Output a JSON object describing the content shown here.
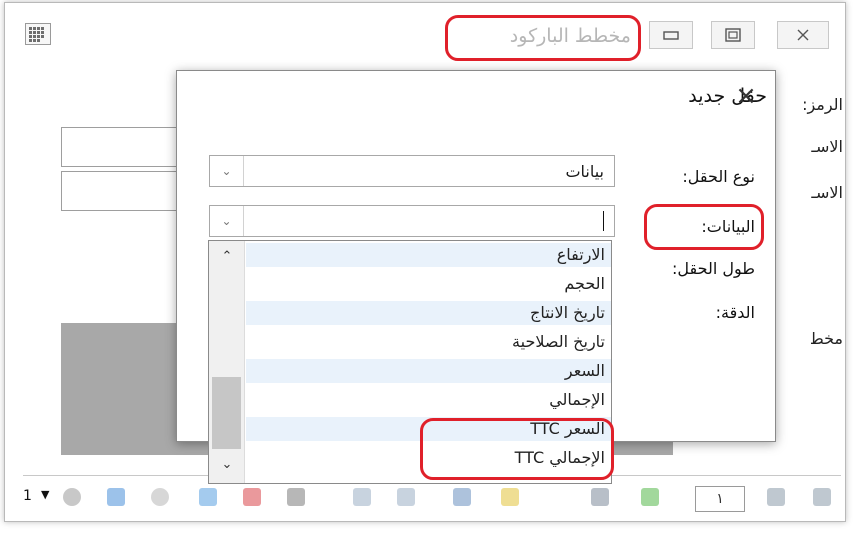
{
  "window": {
    "title": "مخطط الباركود",
    "colors": {
      "annotation": "#e0202a",
      "gray_panel": "#a8a8a8",
      "list_alt_row": "#e9f2fb"
    }
  },
  "background_form": {
    "label_code": "الرمز:",
    "label_name1": "الاسـ",
    "label_name2": "الاسـ",
    "label_scheme": "مخطط"
  },
  "dialog": {
    "title": "حقل جديد",
    "close_icon": "×",
    "field_type_label": "نوع الحقل:",
    "field_type_value": "بيانات",
    "data_label": "البيانات:",
    "data_value": "",
    "field_length_label": "طول الحقل:",
    "precision_label": "الدقة:"
  },
  "dropdown": {
    "items": [
      "الارتفاع",
      "الحجم",
      "تاريخ الانتاج",
      "تاريخ الصلاحية",
      "السعر",
      "الإجمالي",
      "السعر TTC",
      "الإجمالي TTC"
    ]
  },
  "toolbar": {
    "page_count": "1",
    "page_field": "١",
    "icons": [
      "link-icon",
      "sort-icon",
      "filter-icon",
      "refresh-icon",
      "delete-icon",
      "undo-icon",
      "copy-icon",
      "paste-icon",
      "save-icon",
      "favorite-icon",
      "first-page-icon",
      "prev-page-icon",
      "next-page-icon",
      "last-page-icon"
    ]
  }
}
